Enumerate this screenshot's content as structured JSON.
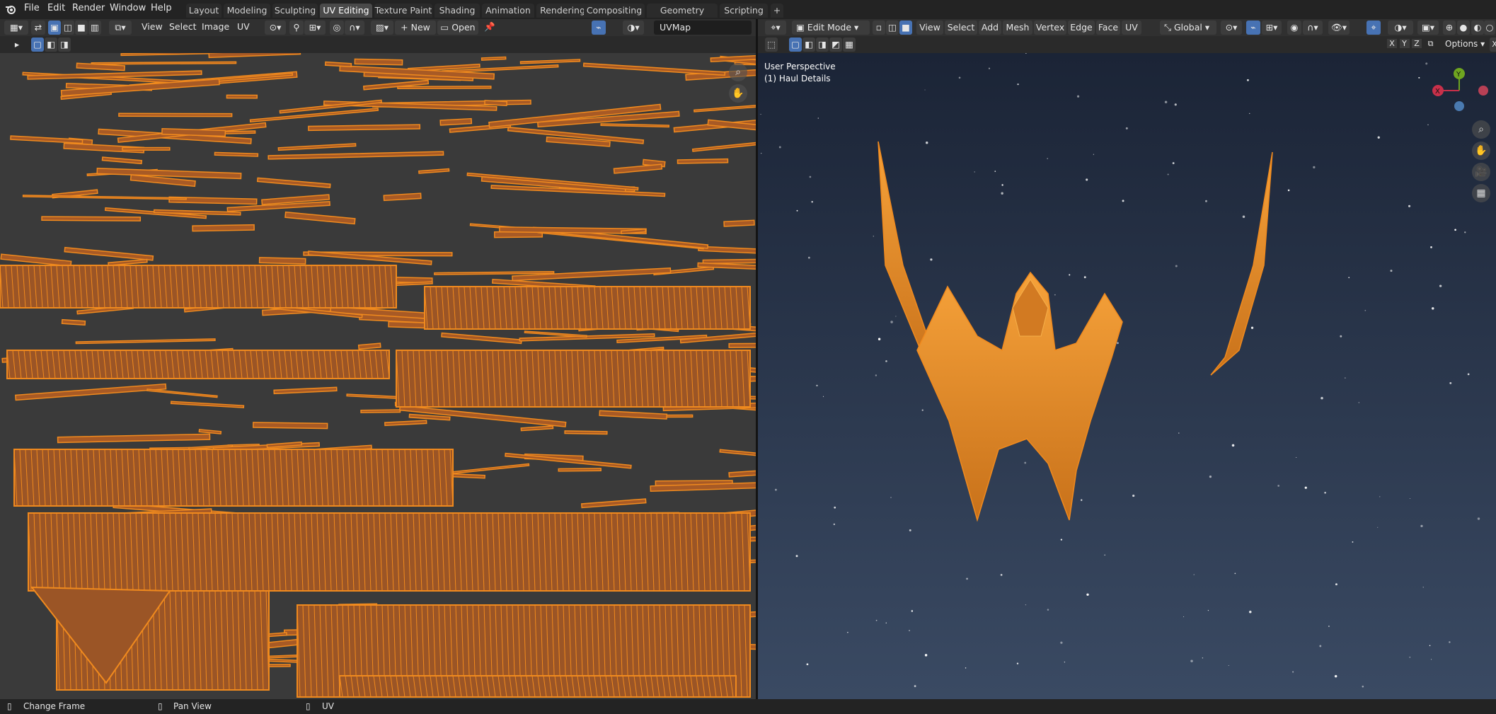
{
  "menu": [
    "File",
    "Edit",
    "Render",
    "Window",
    "Help"
  ],
  "workspaces": [
    "Layout",
    "Modeling",
    "Sculpting",
    "UV Editing",
    "Texture Paint",
    "Shading",
    "Animation",
    "Rendering",
    "Compositing",
    "Geometry Nodes",
    "Scripting"
  ],
  "active_workspace": "UV Editing",
  "uv_editor": {
    "menus": [
      "View",
      "Select",
      "Image",
      "UV"
    ],
    "new_label": "New",
    "open_label": "Open",
    "uvmap_name": "UVMap"
  },
  "viewport": {
    "mode_label": "Edit Mode",
    "menus": [
      "View",
      "Select",
      "Add",
      "Mesh",
      "Vertex",
      "Edge",
      "Face",
      "UV"
    ],
    "orientation": "Global",
    "axes": [
      "X",
      "Y",
      "Z"
    ],
    "options_label": "Options",
    "overlay_line1": "User Perspective",
    "overlay_line2": "(1) Haul Details",
    "gizmo": {
      "x": "X",
      "y": "Y"
    }
  },
  "status": {
    "left": "Change Frame",
    "middle": "Pan View",
    "right": "UV"
  },
  "colors": {
    "accent": "#4772b3",
    "mesh_orange": "#f08a1e",
    "uv_bg": "#3d3d3d",
    "space_bg": "#26304a"
  }
}
